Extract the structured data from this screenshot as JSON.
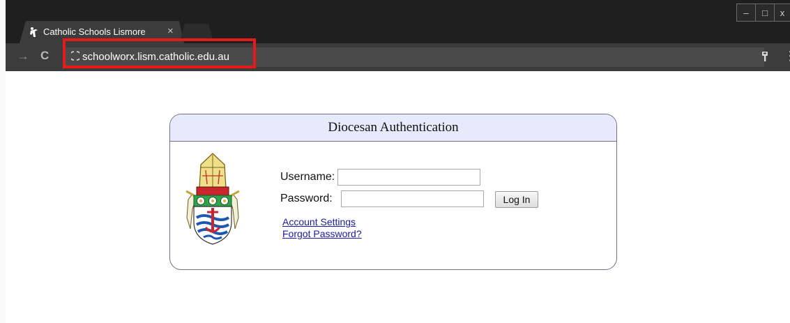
{
  "browser": {
    "tab": {
      "title": "Catholic Schools Lismore",
      "close_glyph": "×",
      "favicon": "tab-favicon-figure"
    },
    "window_controls": {
      "minimize": "–",
      "maximize": "□",
      "close": "x"
    },
    "toolbar": {
      "back_glyph": "→",
      "reload_glyph": "C",
      "url": "schoolworx.lism.catholic.edu.au",
      "key_glyph": "⚲",
      "menu_glyph": "⋮"
    },
    "highlight_color": "#e51a1a"
  },
  "auth": {
    "title": "Diocesan Authentication",
    "username_label": "Username:",
    "username_value": "",
    "password_label": "Password:",
    "password_value": "",
    "login_button": "Log In",
    "links": {
      "account_settings": "Account Settings",
      "forgot_password": "Forgot Password?"
    },
    "crest_icon": "diocesan-crest-icon",
    "header_bg": "#e8eafc",
    "link_color": "#1a1aa6"
  }
}
